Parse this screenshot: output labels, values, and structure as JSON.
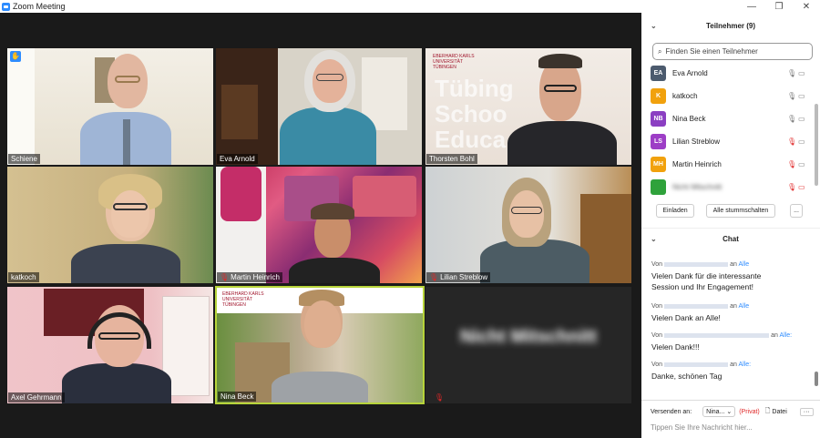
{
  "window": {
    "title": "Zoom Meeting"
  },
  "participants_panel": {
    "title": "Teilnehmer (9)",
    "search_placeholder": "Finden Sie einen Teilnehmer"
  },
  "participants": [
    {
      "initials": "EA",
      "name": "Eva Arnold",
      "color": "#4c5b6e",
      "muted": false
    },
    {
      "initials": "K",
      "name": "katkoch",
      "color": "#f1a10d",
      "muted": false
    },
    {
      "initials": "NB",
      "name": "Nina Beck",
      "color": "#8b3fc2",
      "muted": false
    },
    {
      "initials": "LS",
      "name": "Lilian Streblow",
      "color": "#9d3ec6",
      "muted": true
    },
    {
      "initials": "MH",
      "name": "Martin Heinrich",
      "color": "#f1a10d",
      "muted": true
    },
    {
      "initials": "",
      "name": "Nicht Mitschnitt",
      "color": "#2fa23b",
      "muted": true
    }
  ],
  "buttons": {
    "invite": "Einladen",
    "mute_all": "Alle stummschalten",
    "more": "..."
  },
  "chat": {
    "title": "Chat",
    "from_label": "Von",
    "to_label": "an",
    "messages": [
      {
        "to": "Alle",
        "text_line1": "Vielen Dank für die interessante",
        "text_line2": "Session und Ihr Engagement!"
      },
      {
        "to": "Alle",
        "text_line1": "Vielen Dank an Alle!",
        "text_line2": ""
      },
      {
        "to": "Alle:",
        "text_line1": "Vielen Dank!!!",
        "text_line2": ""
      },
      {
        "to": "Alle:",
        "text_line1": "Danke, schönen Tag",
        "text_line2": ""
      }
    ],
    "send_to_label": "Versenden an:",
    "recipient": "Nina...",
    "private": "(Privat)",
    "file_label": "Datei",
    "input_placeholder": "Tippen Sie Ihre Nachricht hier..."
  },
  "tiles": [
    {
      "name": "Schiene"
    },
    {
      "name": "Eva Arnold"
    },
    {
      "name": "Thorsten Bohl"
    },
    {
      "name": "katkoch"
    },
    {
      "name": "Martin Heinrich"
    },
    {
      "name": "Lilian Streblow"
    },
    {
      "name": "Axel Gehrmann"
    },
    {
      "name": "Nina Beck"
    },
    {
      "name": "Nicht Mitschnitt"
    }
  ],
  "tile_texts": {
    "uni_name_line1": "EBERHARD KARLS",
    "uni_name_line2": "UNIVERSITÄT",
    "uni_name_line3": "TÜBINGEN",
    "banner_word1": "Tübing",
    "banner_word2": "Schoo",
    "banner_word3": "Educa"
  }
}
